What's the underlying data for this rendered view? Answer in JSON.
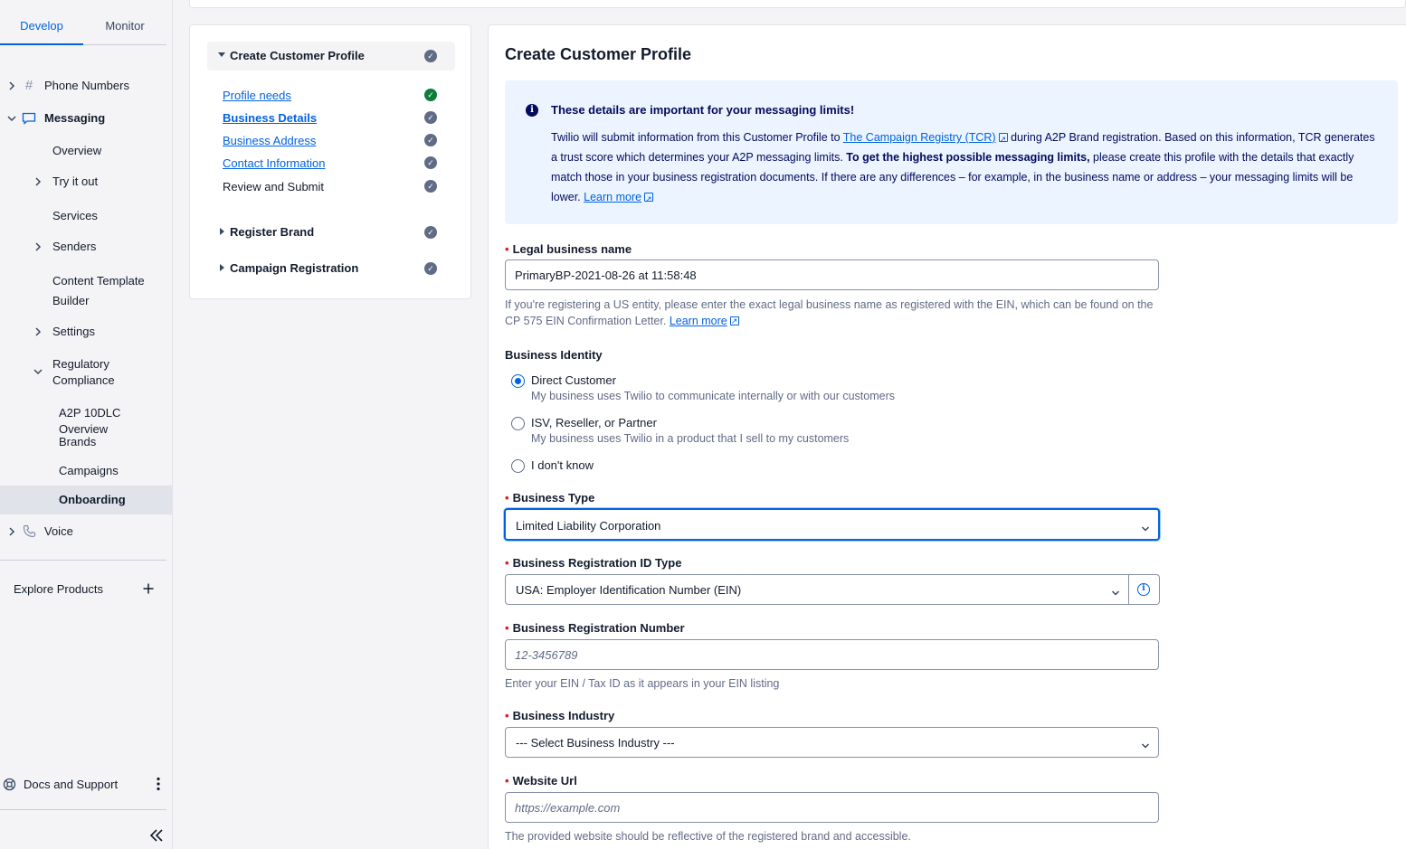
{
  "sidebar": {
    "tabs": [
      {
        "label": "Develop"
      },
      {
        "label": "Monitor"
      }
    ],
    "nav": {
      "phone_numbers": "Phone Numbers",
      "messaging": "Messaging",
      "overview": "Overview",
      "try_it_out": "Try it out",
      "services": "Services",
      "senders": "Senders",
      "content_template_1": "Content Template",
      "content_template_2": "Builder",
      "settings": "Settings",
      "regulatory_1": "Regulatory",
      "regulatory_2": "Compliance",
      "a2p_overview": "A2P 10DLC Overview",
      "brands": "Brands",
      "campaigns": "Campaigns",
      "onboarding": "Onboarding",
      "voice": "Voice"
    },
    "explore_products": "Explore Products",
    "docs_support": "Docs and Support"
  },
  "steps": {
    "create_profile": "Create Customer Profile",
    "substeps": [
      "Profile needs",
      "Business Details",
      "Business Address",
      "Contact Information",
      "Review and Submit"
    ],
    "register_brand": "Register Brand",
    "campaign_registration": "Campaign Registration"
  },
  "form": {
    "title": "Create Customer Profile",
    "callout": {
      "title": "These details are important for your messaging limits!",
      "body_1": "Twilio will submit information from this Customer Profile to ",
      "tcr_link": "The Campaign Registry (TCR)",
      "body_2": " during A2P Brand registration. Based on this information, TCR generates a trust score which determines your A2P messaging limits. ",
      "body_bold": "To get the highest possible messaging limits,",
      "body_3": " please create this profile with the details that exactly match those in your business registration documents. If there are any differences – for example, in the business name or address – your messaging limits will be lower. ",
      "learn_more": "Learn more"
    },
    "legal_name": {
      "label": "Legal business name",
      "value": "PrimaryBP-2021-08-26 at 11:58:48",
      "help": "If you're registering a US entity, please enter the exact legal business name as registered with the EIN, which can be found on the CP 575 EIN Confirmation Letter. ",
      "learn_more": "Learn more"
    },
    "identity": {
      "label": "Business Identity",
      "options": [
        {
          "label": "Direct Customer",
          "sub": "My business uses Twilio to communicate internally or with our customers"
        },
        {
          "label": "ISV, Reseller, or Partner",
          "sub": "My business uses Twilio in a product that I sell to my customers"
        },
        {
          "label": "I don't know",
          "sub": ""
        }
      ]
    },
    "business_type": {
      "label": "Business Type",
      "value": "Limited Liability Corporation"
    },
    "reg_id_type": {
      "label": "Business Registration ID Type",
      "value": "USA: Employer Identification Number (EIN)"
    },
    "reg_number": {
      "label": "Business Registration Number",
      "placeholder": "12-3456789",
      "help": "Enter your EIN / Tax ID as it appears in your EIN listing"
    },
    "industry": {
      "label": "Business Industry",
      "value": "--- Select Business Industry ---"
    },
    "website": {
      "label": "Website Url",
      "placeholder": "https://example.com",
      "help": "The provided website should be reflective of the registered brand and accessible."
    }
  }
}
